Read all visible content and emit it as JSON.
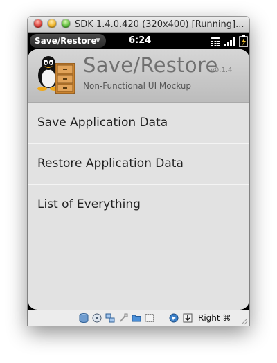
{
  "window": {
    "title": "SDK 1.4.0.420 (320x400) [Running]..."
  },
  "statusbar": {
    "app_menu": "Save/Restore",
    "time": "6:24",
    "icons": [
      "dialer-icon",
      "signal-icon",
      "battery-icon"
    ]
  },
  "app": {
    "title": "Save/Restore",
    "version": "v0.1.4",
    "subtitle": "Non-Functional UI Mockup"
  },
  "list": {
    "items": [
      {
        "label": "Save Application Data"
      },
      {
        "label": "Restore Application Data"
      },
      {
        "label": "List of Everything"
      }
    ]
  },
  "toolbar": {
    "icons": [
      "hard-disk-icon",
      "optical-disc-icon",
      "network-icon",
      "usb-icon",
      "shared-folder-icon",
      "capture-icon",
      "mouse-integration-icon",
      "download-icon"
    ],
    "host_key": "Right ⌘"
  },
  "colors": {
    "header": "#c6c6c6",
    "list_bg": "#e2e2e2",
    "statusbar": "#000000"
  }
}
